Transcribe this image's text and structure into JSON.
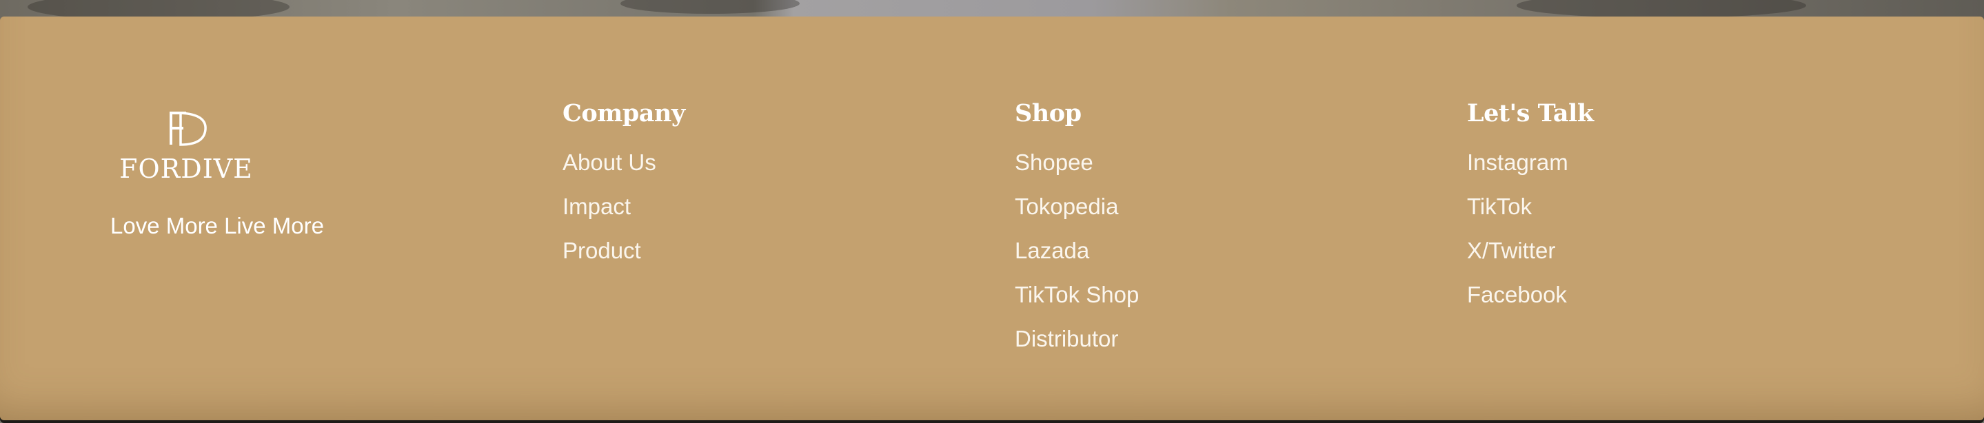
{
  "brand": {
    "logo_text": "FORDIVE",
    "tagline": "Love More Live More"
  },
  "columns": {
    "company": {
      "heading": "Company",
      "links": [
        "About Us",
        "Impact",
        "Product"
      ]
    },
    "shop": {
      "heading": "Shop",
      "links": [
        "Shopee",
        "Tokopedia",
        "Lazada",
        "TikTok Shop",
        "Distributor"
      ]
    },
    "talk": {
      "heading": "Let's Talk",
      "links": [
        "Instagram",
        "TikTok",
        "X/Twitter",
        "Facebook"
      ]
    }
  },
  "colors": {
    "footer_bg": "#c4a16f",
    "text": "#ffffff"
  }
}
